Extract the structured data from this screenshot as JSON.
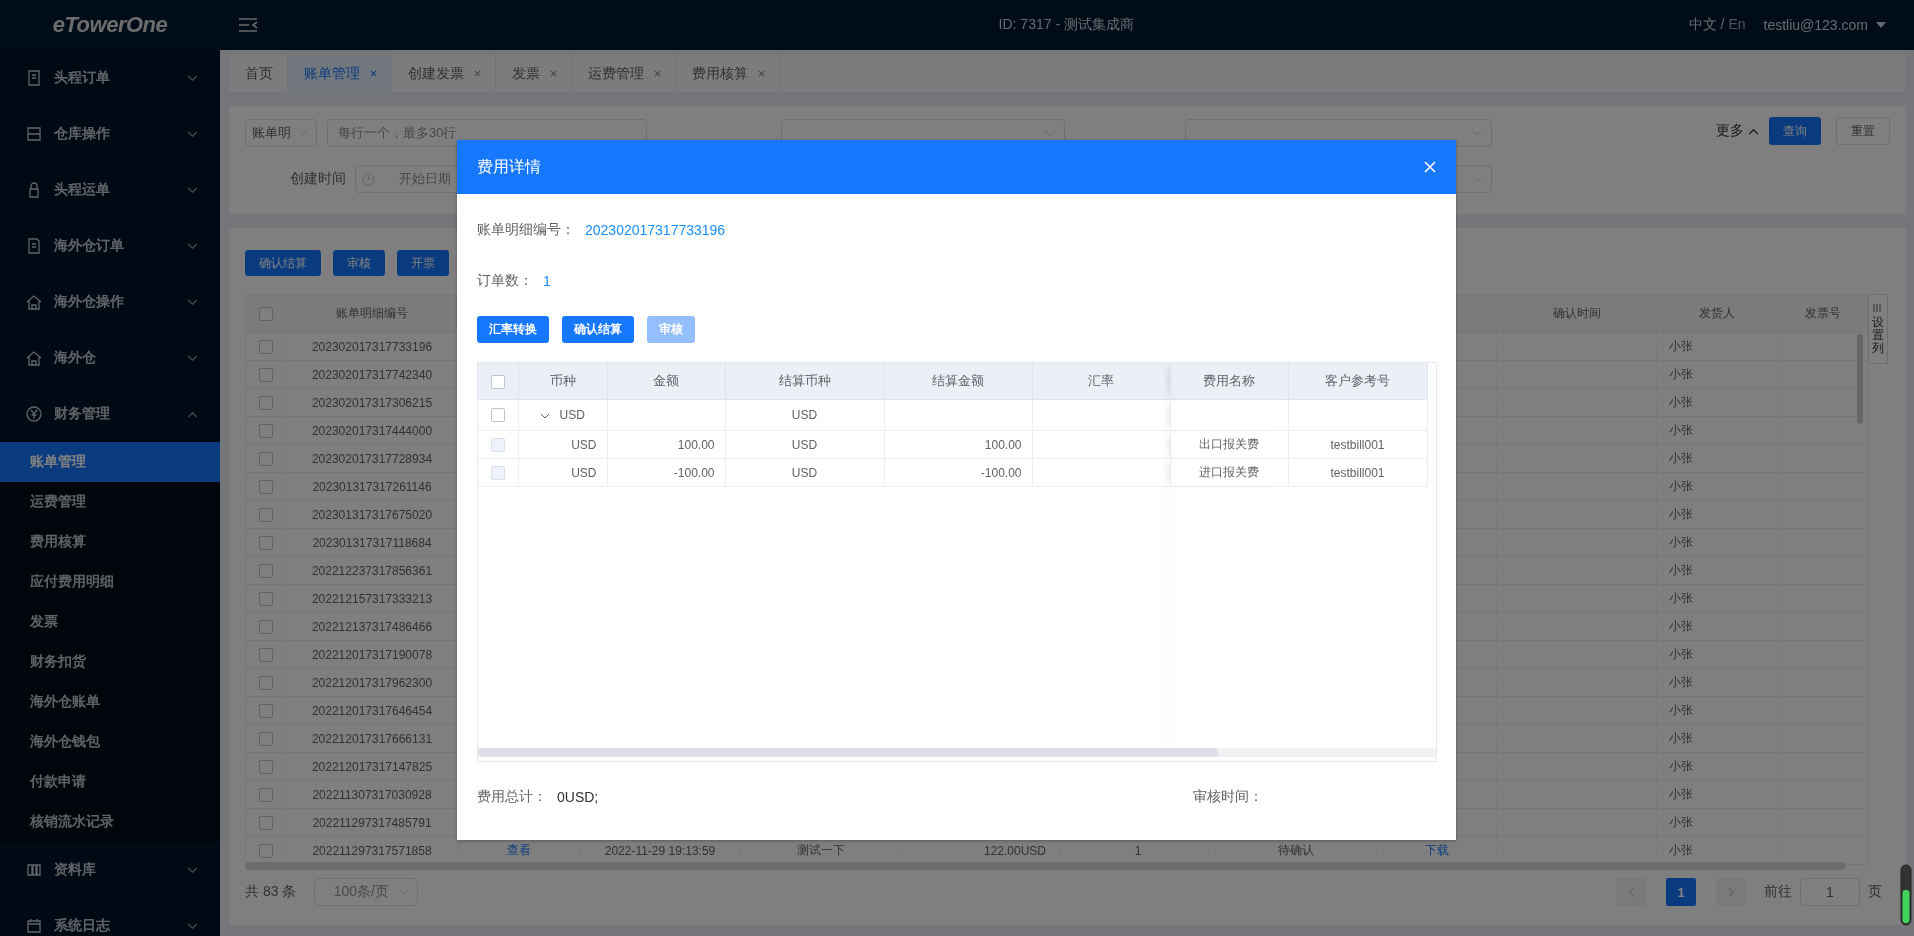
{
  "header": {
    "logo": "eTowerOne",
    "title": "ID: 7317 - 测试集成商",
    "lang_current": "中文",
    "lang_separator": "/",
    "lang_other": "En",
    "user": "testliu@123.com"
  },
  "sidebar": {
    "items": [
      {
        "label": "头程订单",
        "expanded": false
      },
      {
        "label": "仓库操作",
        "expanded": false
      },
      {
        "label": "头程运单",
        "expanded": false
      },
      {
        "label": "海外仓订单",
        "expanded": false
      },
      {
        "label": "海外仓操作",
        "expanded": false
      },
      {
        "label": "海外仓",
        "expanded": false
      },
      {
        "label": "财务管理",
        "expanded": true,
        "children": [
          {
            "label": "账单管理",
            "selected": true
          },
          {
            "label": "运费管理",
            "selected": false
          },
          {
            "label": "费用核算",
            "selected": false
          },
          {
            "label": "应付费用明细",
            "selected": false
          },
          {
            "label": "发票",
            "selected": false
          },
          {
            "label": "财务扣货",
            "selected": false
          },
          {
            "label": "海外仓账单",
            "selected": false
          },
          {
            "label": "海外仓钱包",
            "selected": false
          },
          {
            "label": "付款申请",
            "selected": false
          },
          {
            "label": "核销流水记录",
            "selected": false
          }
        ]
      },
      {
        "label": "资料库",
        "expanded": false
      },
      {
        "label": "系统日志",
        "expanded": false
      }
    ]
  },
  "tabs": [
    {
      "label": "首页",
      "selected": false,
      "closable": false
    },
    {
      "label": "账单管理",
      "selected": true,
      "closable": true
    },
    {
      "label": "创建发票",
      "selected": false,
      "closable": true
    },
    {
      "label": "发票",
      "selected": false,
      "closable": true
    },
    {
      "label": "运费管理",
      "selected": false,
      "closable": true
    },
    {
      "label": "费用核算",
      "selected": false,
      "closable": true
    }
  ],
  "filters": {
    "field_select": {
      "value": "账单明"
    },
    "ids_input": {
      "placeholder": "每行一个，最多30行"
    },
    "created": {
      "label": "创建时间",
      "start_placeholder": "开始日期"
    },
    "more": {
      "label": "更多",
      "expanded": true
    },
    "query": "查询",
    "reset": "重置"
  },
  "toolbar": [
    "确认结算",
    "审核",
    "开票"
  ],
  "table": {
    "all_checked": false,
    "columns": [
      {
        "kind": "text",
        "header": "账单明细编号"
      },
      {
        "kind": "link"
      },
      {
        "kind": "text"
      },
      {
        "kind": "text"
      },
      {
        "kind": "amount"
      },
      {
        "kind": "text"
      },
      {
        "kind": "text"
      },
      {
        "kind": "link"
      },
      {
        "kind": "text",
        "header": "确认时间"
      },
      {
        "kind": "left",
        "header": "发货人"
      },
      {
        "kind": "text",
        "header": "发票号"
      }
    ],
    "column_settings": "设置列",
    "rows": [
      {
        "checked": false,
        "cells": [
          "202302017317733196",
          null,
          null,
          null,
          null,
          null,
          null,
          null,
          null,
          "小张",
          null
        ]
      },
      {
        "checked": false,
        "cells": [
          "202302017317742340",
          null,
          null,
          null,
          null,
          null,
          null,
          null,
          null,
          "小张",
          null
        ]
      },
      {
        "checked": false,
        "cells": [
          "202302017317306215",
          null,
          null,
          null,
          null,
          null,
          null,
          null,
          null,
          "小张",
          null
        ]
      },
      {
        "checked": false,
        "cells": [
          "202302017317444000",
          null,
          null,
          null,
          null,
          null,
          null,
          null,
          null,
          "小张",
          null
        ]
      },
      {
        "checked": false,
        "cells": [
          "202302017317728934",
          null,
          null,
          null,
          null,
          null,
          null,
          null,
          null,
          "小张",
          null
        ]
      },
      {
        "checked": false,
        "cells": [
          "202301317317261146",
          null,
          null,
          null,
          null,
          null,
          null,
          null,
          null,
          "小张",
          null
        ]
      },
      {
        "checked": false,
        "cells": [
          "202301317317675020",
          null,
          null,
          null,
          null,
          null,
          null,
          null,
          null,
          "小张",
          null
        ]
      },
      {
        "checked": false,
        "cells": [
          "202301317317118684",
          null,
          null,
          null,
          null,
          null,
          null,
          null,
          null,
          "小张",
          null
        ]
      },
      {
        "checked": false,
        "cells": [
          "202212237317856361",
          null,
          null,
          null,
          null,
          null,
          null,
          null,
          null,
          "小张",
          null
        ]
      },
      {
        "checked": false,
        "cells": [
          "202212157317333213",
          null,
          null,
          null,
          null,
          null,
          null,
          null,
          null,
          "小张",
          null
        ]
      },
      {
        "checked": false,
        "cells": [
          "202212137317486466",
          null,
          null,
          null,
          null,
          null,
          null,
          null,
          null,
          "小张",
          null
        ]
      },
      {
        "checked": false,
        "cells": [
          "202212017317190078",
          null,
          null,
          null,
          null,
          null,
          null,
          null,
          null,
          "小张",
          null
        ]
      },
      {
        "checked": false,
        "cells": [
          "202212017317962300",
          null,
          null,
          null,
          null,
          null,
          null,
          null,
          null,
          "小张",
          null
        ]
      },
      {
        "checked": false,
        "cells": [
          "202212017317646454",
          null,
          null,
          null,
          null,
          null,
          null,
          null,
          null,
          "小张",
          null
        ]
      },
      {
        "checked": false,
        "cells": [
          "202212017317666131",
          null,
          null,
          null,
          null,
          null,
          null,
          null,
          null,
          "小张",
          null
        ]
      },
      {
        "checked": false,
        "cells": [
          "202212017317147825",
          null,
          null,
          null,
          null,
          null,
          null,
          null,
          null,
          "小张",
          null
        ]
      },
      {
        "checked": false,
        "cells": [
          "202211307317030928",
          null,
          null,
          null,
          null,
          null,
          null,
          null,
          null,
          "小张",
          null
        ]
      },
      {
        "checked": false,
        "cells": [
          "202211297317485791",
          null,
          null,
          null,
          null,
          null,
          null,
          null,
          null,
          "小张",
          null
        ]
      },
      {
        "checked": false,
        "cells": [
          "202211297317571858",
          "查看",
          "2022-11-29 19:13:59",
          "测试一下",
          "122.00USD",
          "1",
          "待确认",
          "下载",
          null,
          "小张",
          null
        ]
      }
    ]
  },
  "pagination": {
    "total": "共 83 条",
    "page_size": "100条/页",
    "pages": [
      {
        "label": "1",
        "selected": true
      }
    ],
    "goto_label": "前往",
    "goto_value": "1",
    "goto_suffix": "页"
  },
  "modal": {
    "title": "费用详情",
    "detail_no_label": "账单明细编号：",
    "detail_no": "202302017317733196",
    "order_count_label": "订单数：",
    "order_count": "1",
    "buttons": [
      {
        "label": "汇率转换",
        "disabled": false
      },
      {
        "label": "确认结算",
        "disabled": false
      },
      {
        "label": "审核",
        "disabled": true
      }
    ],
    "all_checked": false,
    "columns": [
      "币种",
      "金额",
      "结算币种",
      "结算金额",
      "汇率",
      "费用名称",
      "客户参考号"
    ],
    "rows": [
      {
        "currency": "USD",
        "settle_currency": "USD",
        "expanded": true,
        "disabled": false,
        "children": [
          {
            "currency": "USD",
            "amount": "100.00",
            "settle_currency": "USD",
            "settle_amount": "100.00",
            "fee_name": "出口报关费",
            "customer_ref": "testbill001",
            "disabled": true
          },
          {
            "currency": "USD",
            "amount": "-100.00",
            "settle_currency": "USD",
            "settle_amount": "-100.00",
            "fee_name": "进口报关费",
            "customer_ref": "testbill001",
            "disabled": true
          }
        ]
      }
    ],
    "total_label": "费用总计：",
    "total": "0USD;",
    "review_time_label": "审核时间："
  }
}
